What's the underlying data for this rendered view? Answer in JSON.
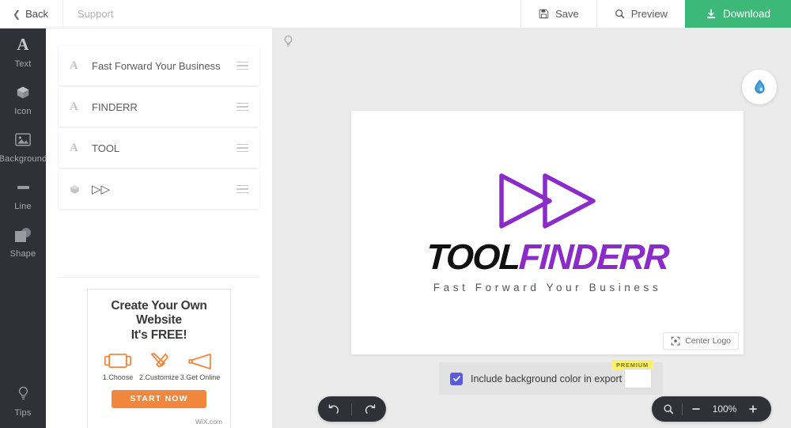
{
  "topbar": {
    "back_label": "Back",
    "back_icon": "chevron-left-icon",
    "support_label": "Support",
    "save_label": "Save",
    "save_icon": "floppy-disk-icon",
    "preview_label": "Preview",
    "preview_icon": "magnifier-icon",
    "download_label": "Download",
    "download_icon": "download-icon",
    "download_color": "#3cb878"
  },
  "rail": {
    "items": [
      {
        "label": "Text",
        "icon": "text-letter-a-icon"
      },
      {
        "label": "Icon",
        "icon": "cube-box-icon"
      },
      {
        "label": "Background",
        "icon": "image-picture-icon"
      },
      {
        "label": "Line",
        "icon": "horizontal-line-icon"
      },
      {
        "label": "Shape",
        "icon": "square-circle-shape-icon"
      }
    ],
    "bottom_item": {
      "label": "Tips",
      "icon": "lightbulb-icon"
    },
    "background_color": "#2f3038"
  },
  "layers": [
    {
      "type_icon": "text-letter-a-icon",
      "name": "Fast Forward Your Business",
      "handle_icon": "drag-handle-icon"
    },
    {
      "type_icon": "text-letter-a-icon",
      "name": "FINDERR",
      "handle_icon": "drag-handle-icon"
    },
    {
      "type_icon": "text-letter-a-icon",
      "name": "TOOL",
      "handle_icon": "drag-handle-icon"
    },
    {
      "type_icon": "cube-box-icon",
      "name": "▷▷",
      "handle_icon": "drag-handle-icon"
    }
  ],
  "ad": {
    "headline_line1": "Create Your Own Website",
    "headline_line2": "It's FREE!",
    "steps": [
      {
        "label": "1.Choose",
        "icon": "template-frame-icon"
      },
      {
        "label": "2.Customize",
        "icon": "tools-wrench-screwdriver-icon"
      },
      {
        "label": "3.Get Online",
        "icon": "megaphone-icon"
      }
    ],
    "cta_label": "START NOW",
    "cta_color": "#f1873c",
    "brand": "WiX",
    "brand_suffix": ".com"
  },
  "stage": {
    "tips_icon": "lightbulb-icon",
    "color_tool_icon": "water-droplet-icon",
    "color_tool_color": "#2f8fd0",
    "background_color": "#ebebeb"
  },
  "logo": {
    "mark_icon": "fast-forward-double-triangle-icon",
    "mark_color": "#8b2bc9",
    "word_dark": "TOOL",
    "word_accent": "FINDERR",
    "word_dark_color": "#111111",
    "word_accent_color": "#8b2bc9",
    "tagline": "Fast Forward Your Business",
    "tagline_color": "#55555a"
  },
  "center_logo": {
    "label": "Center Logo",
    "icon": "center-crosshair-icon"
  },
  "bg_export": {
    "checkbox_checked": true,
    "checkbox_color": "#5b5be0",
    "label": "Include background color in export",
    "premium_badge": "PREMIUM",
    "premium_badge_color": "#fdf06a",
    "swatch_color": "#ffffff"
  },
  "bottom_controls": {
    "undo_icon": "undo-arrow-icon",
    "redo_icon": "redo-arrow-icon",
    "zoom_search_icon": "magnifier-icon",
    "zoom_out_icon": "minus-icon",
    "zoom_in_icon": "plus-icon",
    "zoom_value": "100%"
  }
}
